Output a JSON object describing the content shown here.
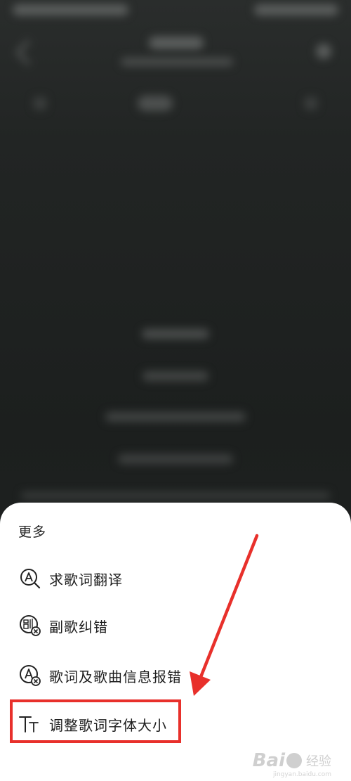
{
  "sheet": {
    "title": "更多",
    "items": [
      {
        "label": "求歌词翻译",
        "icon": "translate-search-icon"
      },
      {
        "label": "副歌纠错",
        "icon": "chorus-correct-icon"
      },
      {
        "label": "歌词及歌曲信息报错",
        "icon": "lyrics-error-report-icon"
      },
      {
        "label": "调整歌词字体大小",
        "icon": "font-size-icon"
      }
    ]
  },
  "annotation": {
    "color": "#e8302b"
  },
  "watermark": {
    "logo": "Bai",
    "cn": "经验",
    "url": "jingyan.baidu.com"
  }
}
